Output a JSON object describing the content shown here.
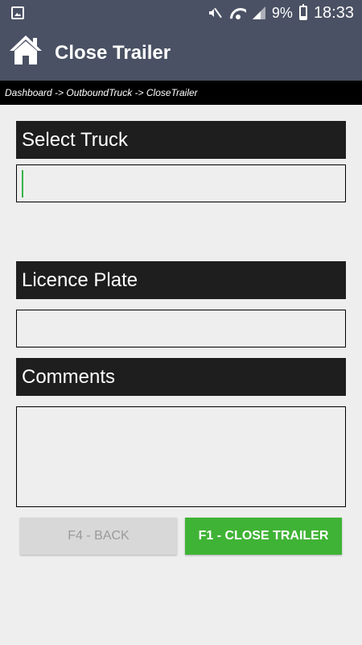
{
  "status_bar": {
    "battery_percent": "9%",
    "time": "18:33",
    "icons": [
      "image-icon",
      "mute-icon",
      "wifi-icon",
      "signal-icon",
      "battery-charging-icon"
    ]
  },
  "app_bar": {
    "title": "Close Trailer",
    "home_icon": "home-icon"
  },
  "breadcrumb": "Dashboard -> OutboundTruck -> CloseTrailer",
  "form": {
    "select_truck_label": "Select Truck",
    "select_truck_value": "",
    "licence_plate_label": "Licence Plate",
    "licence_plate_value": "",
    "comments_label": "Comments",
    "comments_value": ""
  },
  "buttons": {
    "back_label": "F4 - BACK",
    "close_trailer_label": "F1 - CLOSE TRAILER"
  },
  "colors": {
    "app_bar": "#4a5164",
    "header_bg": "#1e1e1e",
    "primary_button": "#3fb335",
    "secondary_button": "#d8d8d8",
    "cursor": "#38b34a"
  }
}
